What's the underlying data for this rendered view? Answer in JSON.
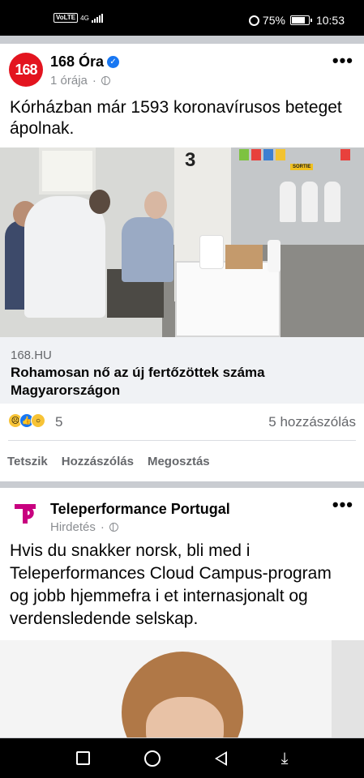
{
  "status_bar": {
    "network": "4G",
    "volte": "VoLTE",
    "battery": "75%",
    "time": "10:53"
  },
  "post1": {
    "page_name": "168 Óra",
    "avatar_text": "168",
    "time": "1 órája",
    "text": "Kórházban már 1593 koronavírusos beteget ápolnak.",
    "link_domain": "168.HU",
    "link_title": "Rohamosan nő az új fertőzöttek száma Magyarországon",
    "reaction_count": "5",
    "comment_count": "5 hozzászólás",
    "actions": [
      "Tetszik",
      "Hozzászólás",
      "Megosztás"
    ],
    "photo_sign_number": "3",
    "photo_sign_sortie": "SORTIE"
  },
  "post2": {
    "page_name": "Teleperformance Portugal",
    "sponsored": "Hirdetés",
    "text": "Hvis du snakker norsk, bli med i Teleperformances Cloud Campus-program og jobb hjemmefra i et internasjonalt og verdensledende selskap."
  },
  "colors": {
    "accent": "#1877f2",
    "brand_168": "#e3141f",
    "teleperformance": "#c8007f"
  },
  "icons": [
    "alarm-icon",
    "battery-icon",
    "verified-badge-icon",
    "globe-icon",
    "more-options-icon",
    "recents-nav-icon",
    "home-nav-icon",
    "back-nav-icon",
    "notification-nav-icon"
  ]
}
